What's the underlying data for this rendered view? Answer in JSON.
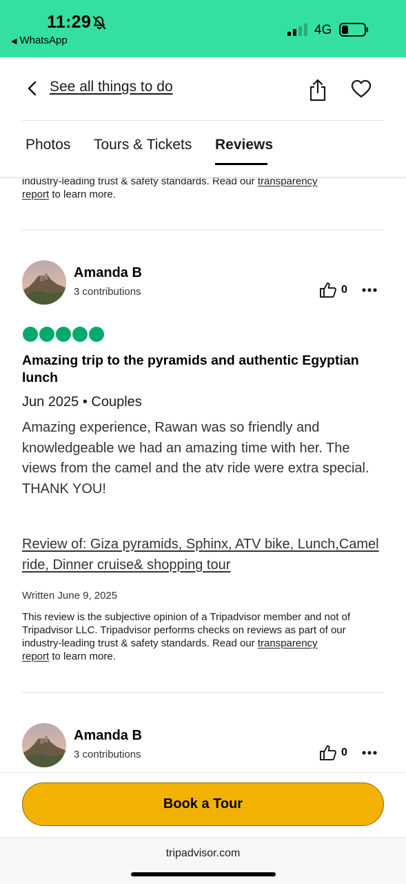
{
  "status_bar": {
    "time": "11:29",
    "back_app": "WhatsApp",
    "network": "4G",
    "background": "#34e0a1",
    "icons": [
      "bell-slash-icon",
      "signal-bars-icon",
      "battery-icon"
    ]
  },
  "header": {
    "back_link": "See all things to do",
    "icons": [
      "chevron-left-icon",
      "share-icon",
      "heart-icon"
    ]
  },
  "tabs": [
    {
      "label": "Photos",
      "active": false
    },
    {
      "label": "Tours & Tickets",
      "active": false
    },
    {
      "label": "Reviews",
      "active": true
    }
  ],
  "top_disclaimer": {
    "line1": "industry-leading trust & safety standards. Read our ",
    "link1": "transparency",
    "link2": "report",
    "rest": " to learn more."
  },
  "reviews": [
    {
      "name": "Amanda B",
      "contributions": "3 contributions",
      "likes": "0",
      "rating": 5,
      "title": "Amazing trip to the pyramids and authentic Egyptian lunch",
      "meta": "Jun 2025 • Couples",
      "body": "Amazing experience, Rawan was so friendly and knowledgeable we had an amazing time with her. The views from the camel and the atv ride were extra special.\nTHANK YOU!",
      "review_of": "Review of: Giza pyramids, Sphinx, ATV bike, Lunch,Camel ride, Dinner cruise& shopping tour",
      "written": "Written June 9, 2025",
      "disclaimer_text": "This review is the subjective opinion of a Tripadvisor member and not of Tripadvisor LLC. Tripadvisor performs checks on reviews as part of our industry-leading trust & safety standards. Read our ",
      "disclaimer_link1": "transparency",
      "disclaimer_link2": "report",
      "disclaimer_rest": " to learn more."
    },
    {
      "name": "Amanda B",
      "contributions": "3 contributions",
      "likes": "0"
    }
  ],
  "cta": {
    "label": "Book a Tour",
    "color": "#f2b203"
  },
  "browser": {
    "url": "tripadvisor.com"
  },
  "rating_color": "#00aa6c"
}
